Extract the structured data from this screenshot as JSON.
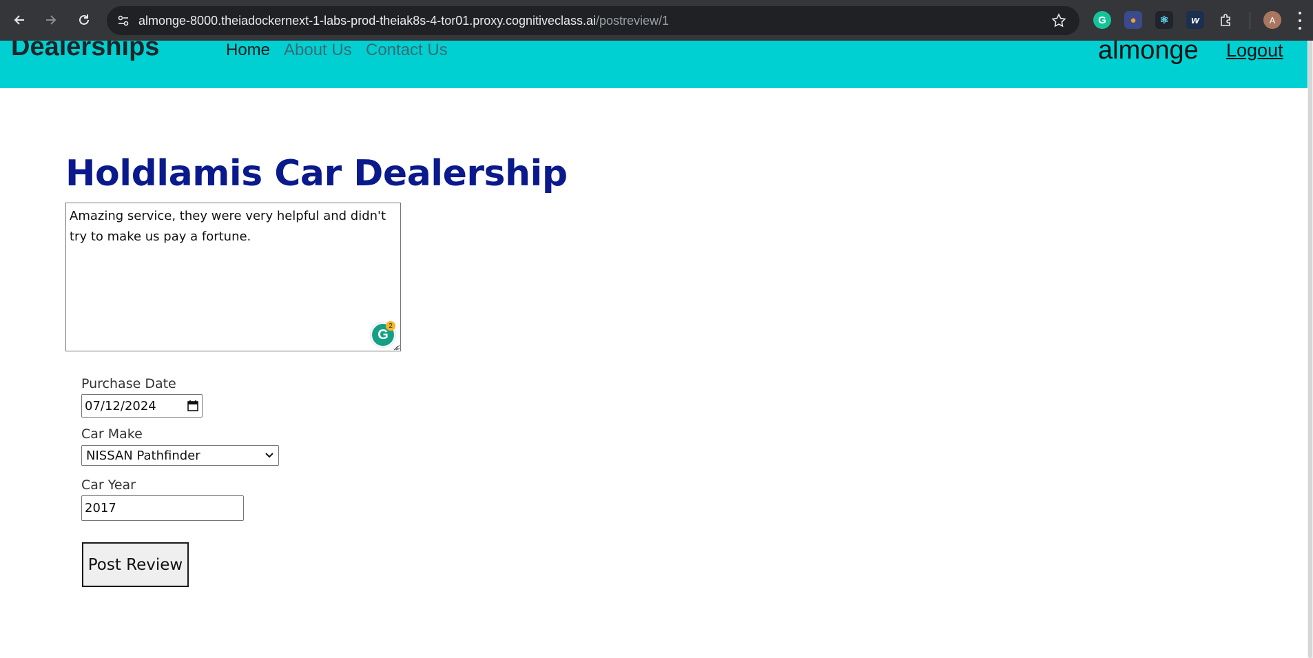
{
  "browser": {
    "url_host": "almonge-8000.theiadockernext-1-labs-prod-theiak8s-4-tor01.proxy.cognitiveclass.ai",
    "url_path": "/postreview/1",
    "avatar_letter": "A",
    "extensions": [
      {
        "name": "grammarly-extension-icon",
        "glyph": "G",
        "color": "#15c39a"
      },
      {
        "name": "owl-extension-icon",
        "glyph": "●",
        "color": "#e0a040"
      },
      {
        "name": "react-devtools-extension-icon",
        "glyph": "⚛",
        "color": "#61dafb"
      },
      {
        "name": "wordtune-extension-icon",
        "glyph": "w",
        "color": "#ffffff"
      }
    ]
  },
  "navbar": {
    "brand": "Dealerships",
    "links": {
      "home": "Home",
      "about": "About Us",
      "contact": "Contact Us"
    },
    "username": "almonge",
    "logout": "Logout",
    "color": "#00d0d2"
  },
  "review_form": {
    "dealer_name": "Holdlamis Car Dealership",
    "review_text": "Amazing service, they were very helpful and didn't try to make us pay a fortune.",
    "grammarly_count": "2",
    "purchase_date_label": "Purchase Date",
    "purchase_date_value": "07/12/2024",
    "car_make_label": "Car Make",
    "car_make_value": "NISSAN Pathfinder",
    "car_year_label": "Car Year",
    "car_year_value": "2017",
    "submit_label": "Post Review"
  }
}
